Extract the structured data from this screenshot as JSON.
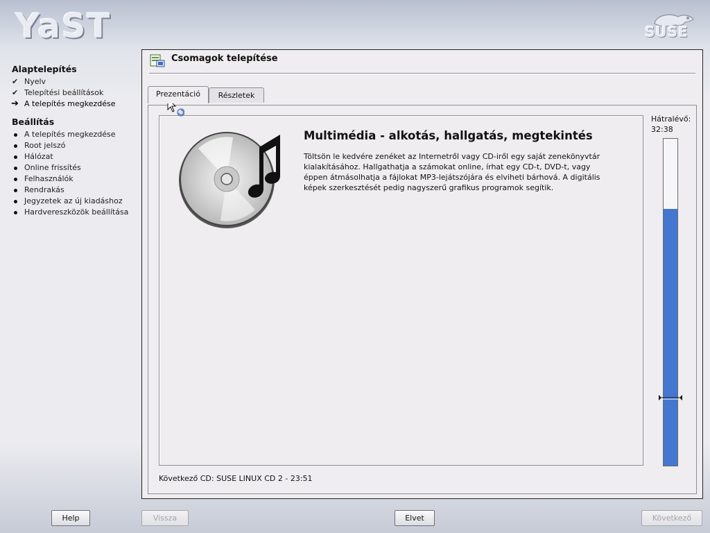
{
  "header": {
    "app_logo": "YaST",
    "brand_logo": "SUSE"
  },
  "sidebar": {
    "sections": [
      {
        "heading": "Alaptelepítés",
        "items": [
          {
            "label": "Nyelv",
            "status": "done"
          },
          {
            "label": "Telepítési beállítások",
            "status": "done"
          },
          {
            "label": "A telepítés megkezdése",
            "status": "current"
          }
        ]
      },
      {
        "heading": "Beállítás",
        "items": [
          {
            "label": "A telepítés megkezdése",
            "status": "pending"
          },
          {
            "label": "Root jelszó",
            "status": "pending"
          },
          {
            "label": "Hálózat",
            "status": "pending"
          },
          {
            "label": "Online frissítés",
            "status": "pending"
          },
          {
            "label": "Felhasználók",
            "status": "pending"
          },
          {
            "label": "Rendrakás",
            "status": "pending"
          },
          {
            "label": "Jegyzetek az új kiadáshoz",
            "status": "pending"
          },
          {
            "label": "Hardvereszközök beállítása",
            "status": "pending"
          }
        ]
      }
    ]
  },
  "main": {
    "title": "Csomagok telepítése",
    "tabs": [
      {
        "label": "Prezentáció",
        "active": true
      },
      {
        "label": "Részletek",
        "active": false
      }
    ],
    "slide": {
      "title": "Multimédia - alkotás, hallgatás, megtekintés",
      "text": "Töltsön le kedvére zenéket az Internetről vagy CD-iről egy saját zenekönyvtár kialakításához. Hallgathatja a számokat online, írhat egy CD-t, DVD-t, vagy éppen átmásolhatja a fájlokat MP3-lejátszójára és elviheti bárhová. A digitális képek szerkesztését pedig nagyszerű grafikus programok segítik."
    },
    "remaining": {
      "label": "Hátralévő:",
      "time": "32:38"
    },
    "progress": {
      "fraction_complete": 0.785,
      "marker_fraction": 0.21
    },
    "next_cd": "Következő CD: SUSE LINUX CD 2 - 23:51"
  },
  "buttons": {
    "help": {
      "label": "Help",
      "enabled": true
    },
    "back": {
      "label": "Vissza",
      "enabled": false
    },
    "abort": {
      "label": "Elvet",
      "enabled": true
    },
    "next": {
      "label": "Következő",
      "enabled": false
    }
  },
  "colors": {
    "progress_fill": "#4477cf",
    "panel_bg": "#efedf0"
  },
  "icons": [
    "package-install-icon",
    "cd-music-icon",
    "check-icon",
    "arrow-right-icon",
    "bullet-icon",
    "mouse-cursor-icon",
    "suse-chameleon-logo"
  ]
}
